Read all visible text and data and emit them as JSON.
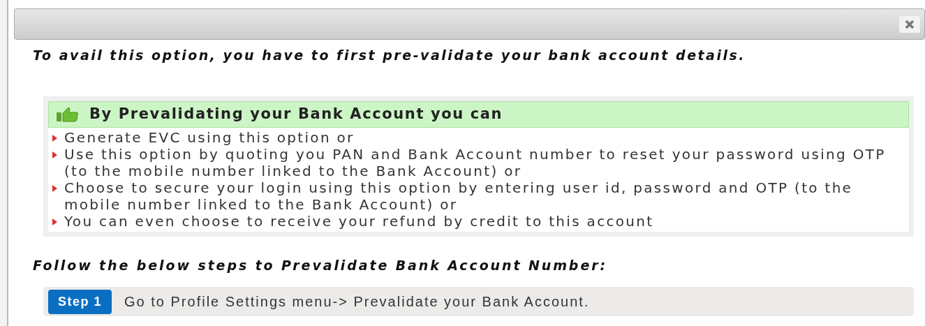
{
  "intro": "To avail this option, you have to first pre-validate your bank account details.",
  "benefits": {
    "title": "By Prevalidating your Bank Account you can",
    "items": [
      "Generate EVC using this option or",
      "Use this option by quoting you PAN and Bank Account number to reset your password using OTP (to the mobile number linked to the Bank Account) or",
      "Choose to secure your login using this option by entering user id, password and OTP (to the mobile number linked to the Bank Account) or",
      "You can even choose to receive your refund by credit to this account"
    ]
  },
  "steps_heading": "Follow the below steps to Prevalidate Bank Account Number:",
  "steps": [
    {
      "label": "Step 1",
      "text": "Go to Profile Settings menu-> Prevalidate your Bank Account."
    }
  ]
}
